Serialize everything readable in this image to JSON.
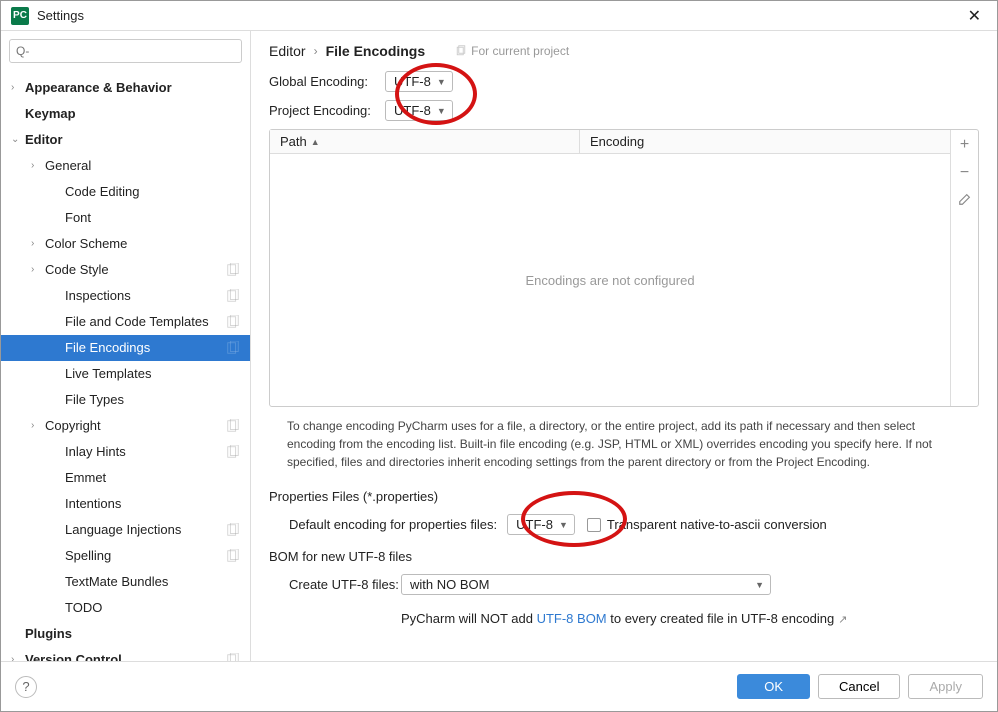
{
  "title": "Settings",
  "search_placeholder": "Q-",
  "breadcrumb": {
    "parent": "Editor",
    "current": "File Encodings",
    "hint": "For current project"
  },
  "tree": [
    {
      "label": "Appearance & Behavior",
      "indent": 0,
      "chevron": "›",
      "bold": true
    },
    {
      "label": "Keymap",
      "indent": 0,
      "bold": true
    },
    {
      "label": "Editor",
      "indent": 0,
      "chevron": "⌄",
      "bold": true
    },
    {
      "label": "General",
      "indent": 1,
      "chevron": "›"
    },
    {
      "label": "Code Editing",
      "indent": 2
    },
    {
      "label": "Font",
      "indent": 2
    },
    {
      "label": "Color Scheme",
      "indent": 1,
      "chevron": "›"
    },
    {
      "label": "Code Style",
      "indent": 1,
      "chevron": "›",
      "badge": true
    },
    {
      "label": "Inspections",
      "indent": 2,
      "badge": true
    },
    {
      "label": "File and Code Templates",
      "indent": 2,
      "badge": true
    },
    {
      "label": "File Encodings",
      "indent": 2,
      "badge": true,
      "selected": true
    },
    {
      "label": "Live Templates",
      "indent": 2
    },
    {
      "label": "File Types",
      "indent": 2
    },
    {
      "label": "Copyright",
      "indent": 1,
      "chevron": "›",
      "badge": true
    },
    {
      "label": "Inlay Hints",
      "indent": 2,
      "badge": true
    },
    {
      "label": "Emmet",
      "indent": 2
    },
    {
      "label": "Intentions",
      "indent": 2
    },
    {
      "label": "Language Injections",
      "indent": 2,
      "badge": true
    },
    {
      "label": "Spelling",
      "indent": 2,
      "badge": true
    },
    {
      "label": "TextMate Bundles",
      "indent": 2
    },
    {
      "label": "TODO",
      "indent": 2
    },
    {
      "label": "Plugins",
      "indent": 0,
      "bold": true
    },
    {
      "label": "Version Control",
      "indent": 0,
      "chevron": "›",
      "bold": true,
      "badge": true
    }
  ],
  "form": {
    "global_label": "Global Encoding:",
    "global_value": "UTF-8",
    "project_label": "Project Encoding:",
    "project_value": "UTF-8"
  },
  "table": {
    "col_path": "Path",
    "col_encoding": "Encoding",
    "empty_msg": "Encodings are not configured"
  },
  "help_text": "To change encoding PyCharm uses for a file, a directory, or the entire project, add its path if necessary and then select encoding from the encoding list. Built-in file encoding (e.g. JSP, HTML or XML) overrides encoding you specify here. If not specified, files and directories inherit encoding settings from the parent directory or from the Project Encoding.",
  "properties": {
    "section": "Properties Files (*.properties)",
    "default_label": "Default encoding for properties files:",
    "default_value": "UTF-8",
    "transparent_label": "Transparent native-to-ascii conversion"
  },
  "bom": {
    "section": "BOM for new UTF-8 files",
    "create_label": "Create UTF-8 files:",
    "create_value": "with NO BOM",
    "note_prefix": "PyCharm will NOT add ",
    "note_link": "UTF-8 BOM",
    "note_suffix": " to every created file in UTF-8 encoding"
  },
  "buttons": {
    "ok": "OK",
    "cancel": "Cancel",
    "apply": "Apply"
  }
}
